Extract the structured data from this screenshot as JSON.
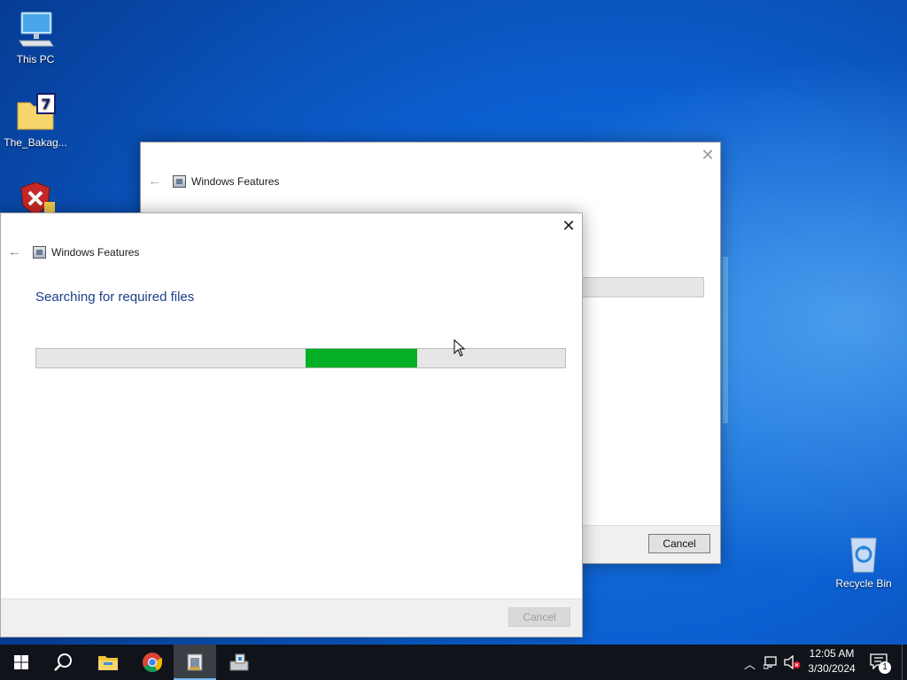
{
  "desktop": {
    "icons": [
      {
        "label": "This PC",
        "icon": "this-pc-icon"
      },
      {
        "label": "The_Bakag...",
        "icon": "7zip-archive-icon"
      },
      {
        "label": "",
        "icon": "security-shield-icon"
      },
      {
        "label": "Recycle Bin",
        "icon": "recycle-bin-icon"
      }
    ]
  },
  "back_window": {
    "title": "Windows Features",
    "cancel_label": "Cancel"
  },
  "front_window": {
    "title": "Windows Features",
    "heading": "Searching for required files",
    "progress_start_pct": 51,
    "progress_end_pct": 72,
    "cancel_label": "Cancel"
  },
  "taskbar": {
    "apps": [
      "start-icon",
      "search-icon",
      "file-explorer-icon",
      "chrome-icon",
      "windows-features-icon",
      "installer-icon"
    ],
    "time": "12:05 AM",
    "date": "3/30/2024",
    "notification_count": "1"
  },
  "colors": {
    "progress_fill": "#06b025",
    "heading_text": "#1a3f8a",
    "taskbar_bg": "#101319"
  }
}
